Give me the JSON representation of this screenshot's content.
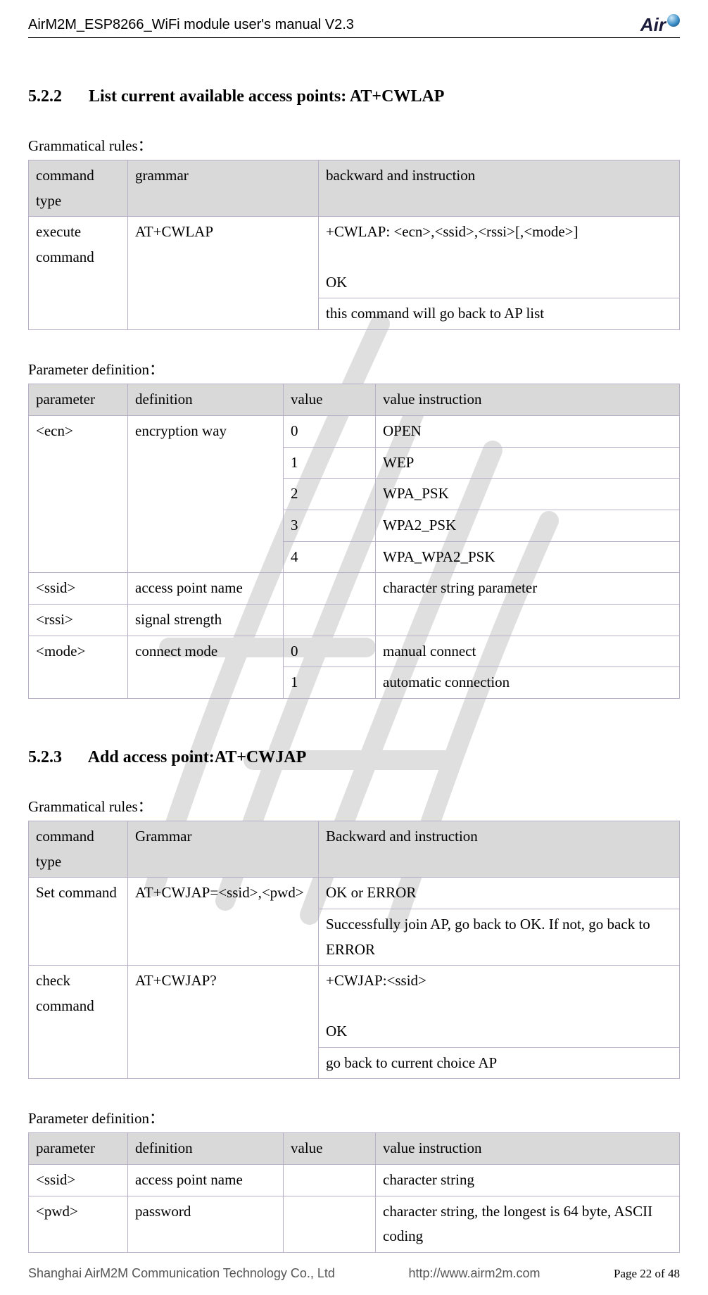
{
  "header": {
    "title": "AirM2M_ESP8266_WiFi module user's manual V2.3",
    "logo_text": "Air"
  },
  "s522": {
    "number": "5.2.2",
    "title": "List current available access points: AT+CWLAP",
    "grammar_label": "Grammatical rules：",
    "grammar_head": {
      "c1": "command type",
      "c2": "grammar",
      "c3": "backward and instruction"
    },
    "grammar_rows": {
      "r0": {
        "c1": "execute command",
        "c2": "AT+CWLAP",
        "c3a": "+CWLAP: <ecn>,<ssid>,<rssi>[,<mode>]\n\nOK",
        "c3b": "this command will go back to AP list"
      }
    },
    "param_label": "Parameter definition：",
    "param_head": {
      "c1": "parameter",
      "c2": "definition",
      "c3": "value",
      "c4": "value instruction"
    },
    "param_rows": {
      "ecn": {
        "c1": "<ecn>",
        "c2": "encryption way"
      },
      "ecn_v": [
        {
          "v": "0",
          "d": "OPEN"
        },
        {
          "v": "1",
          "d": "WEP"
        },
        {
          "v": "2",
          "d": "WPA_PSK"
        },
        {
          "v": "3",
          "d": "WPA2_PSK"
        },
        {
          "v": "4",
          "d": "WPA_WPA2_PSK"
        }
      ],
      "ssid": {
        "c1": "<ssid>",
        "c2": "access point name",
        "c3": "",
        "c4": "character string parameter"
      },
      "rssi": {
        "c1": "<rssi>",
        "c2": "signal strength",
        "c3": "",
        "c4": ""
      },
      "mode": {
        "c1": "<mode>",
        "c2": "connect mode"
      },
      "mode_v": [
        {
          "v": "0",
          "d": "manual connect"
        },
        {
          "v": "1",
          "d": "automatic connection"
        }
      ]
    }
  },
  "s523": {
    "number": "5.2.3",
    "title": "Add access point:AT+CWJAP",
    "grammar_label": "Grammatical rules：",
    "grammar_head": {
      "c1": "command type",
      "c2": "Grammar",
      "c3": "Backward and instruction"
    },
    "grammar_rows": {
      "r0": {
        "c1": "Set command",
        "c2": "AT+CWJAP=<ssid>,<pwd>",
        "c3a": "OK or ERROR",
        "c3b": "Successfully join AP, go back to OK. If not, go back to ERROR"
      },
      "r1": {
        "c1": "check command",
        "c2": "AT+CWJAP?",
        "c3a": "+CWJAP:<ssid>\n\nOK",
        "c3b": "go back to current choice AP"
      }
    },
    "param_label": "Parameter definition：",
    "param_head": {
      "c1": "parameter",
      "c2": "definition",
      "c3": "value",
      "c4": "value instruction"
    },
    "param_rows": {
      "ssid": {
        "c1": "<ssid>",
        "c2": "access point name",
        "c3": "",
        "c4": "character string"
      },
      "pwd": {
        "c1": "<pwd>",
        "c2": "password",
        "c3": "",
        "c4": "character string, the longest is 64 byte, ASCII coding"
      }
    }
  },
  "footer": {
    "company": "Shanghai AirM2M Communication Technology Co., Ltd",
    "url": "http://www.airm2m.com",
    "page": "Page 22 of 48"
  }
}
